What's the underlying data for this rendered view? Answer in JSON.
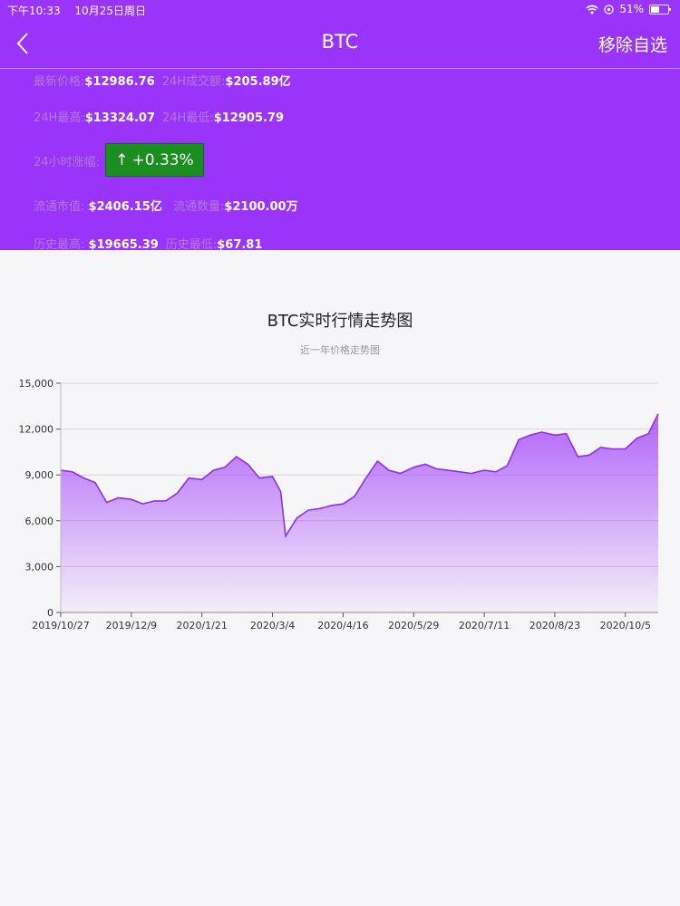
{
  "status_bar": {
    "time": "下午10:33",
    "date": "10月25日周日",
    "battery": "51%",
    "icons": [
      "wifi-icon",
      "location-icon",
      "battery-icon"
    ]
  },
  "nav": {
    "back_icon": "chevron-left-icon",
    "title": "BTC",
    "remove_label": "移除自选"
  },
  "info": {
    "latest_price_label": "最新价格:",
    "latest_price": "$12986.76",
    "volume_24h_label": "24H成交额:",
    "volume_24h": "$205.89亿",
    "high_24h_label": "24H最高:",
    "high_24h": "$13324.07",
    "low_24h_label": "24H最低:",
    "low_24h": "$12905.79",
    "change_24h_label": "24小时涨幅:",
    "change_arrow": "↑",
    "change_24h": "+0.33%",
    "market_cap_label": "流通市值:",
    "market_cap": "$2406.15亿",
    "circulating_label": "流通数量:",
    "circulating": "$2100.00万",
    "ath_label": "历史最高:",
    "ath": "$19665.39",
    "atl_label": "历史最低:",
    "atl": "$67.81"
  },
  "colors": {
    "header_bg": "#9b34fb",
    "change_up": "#1a8f1f",
    "line": "#8e2ff0"
  },
  "chart_data": {
    "type": "area",
    "title": "BTC实时行情走势图",
    "subtitle": "近一年价格走势图",
    "xlabel": "",
    "ylabel": "",
    "ylim": [
      0,
      15000
    ],
    "yticks": [
      0,
      3000,
      6000,
      9000,
      12000,
      15000
    ],
    "ytick_labels": [
      "0",
      "3,000",
      "6,000",
      "9,000",
      "12,000",
      "15,000"
    ],
    "xticks": [
      "2019/10/27",
      "2019/12/9",
      "2020/1/21",
      "2020/3/4",
      "2020/4/16",
      "2020/5/29",
      "2020/7/11",
      "2020/8/23",
      "2020/10/5"
    ],
    "grid": true,
    "series": [
      {
        "x": [
          "2019/10/27",
          "2019/11/3",
          "2019/11/10",
          "2019/11/17",
          "2019/11/24",
          "2019/12/1",
          "2019/12/9",
          "2019/12/16",
          "2019/12/23",
          "2019/12/30",
          "2020/1/6",
          "2020/1/13",
          "2020/1/21",
          "2020/1/28",
          "2020/2/4",
          "2020/2/11",
          "2020/2/18",
          "2020/2/25",
          "2020/3/4",
          "2020/3/9",
          "2020/3/12",
          "2020/3/19",
          "2020/3/26",
          "2020/4/2",
          "2020/4/9",
          "2020/4/16",
          "2020/4/23",
          "2020/4/30",
          "2020/5/7",
          "2020/5/14",
          "2020/5/21",
          "2020/5/29",
          "2020/6/5",
          "2020/6/12",
          "2020/6/19",
          "2020/6/26",
          "2020/7/3",
          "2020/7/11",
          "2020/7/18",
          "2020/7/25",
          "2020/8/1",
          "2020/8/8",
          "2020/8/15",
          "2020/8/23",
          "2020/8/30",
          "2020/9/6",
          "2020/9/13",
          "2020/9/20",
          "2020/9/27",
          "2020/10/5",
          "2020/10/12",
          "2020/10/19",
          "2020/10/25"
        ],
        "values": [
          9300,
          9200,
          8800,
          8500,
          7200,
          7500,
          7400,
          7100,
          7300,
          7300,
          7800,
          8800,
          8700,
          9300,
          9500,
          10200,
          9700,
          8800,
          8900,
          7900,
          5000,
          6200,
          6700,
          6800,
          7000,
          7100,
          7600,
          8800,
          9900,
          9300,
          9100,
          9500,
          9700,
          9400,
          9300,
          9200,
          9100,
          9300,
          9200,
          9600,
          11300,
          11600,
          11800,
          11600,
          11700,
          10200,
          10300,
          10800,
          10700,
          10700,
          11400,
          11700,
          13000
        ]
      }
    ]
  }
}
